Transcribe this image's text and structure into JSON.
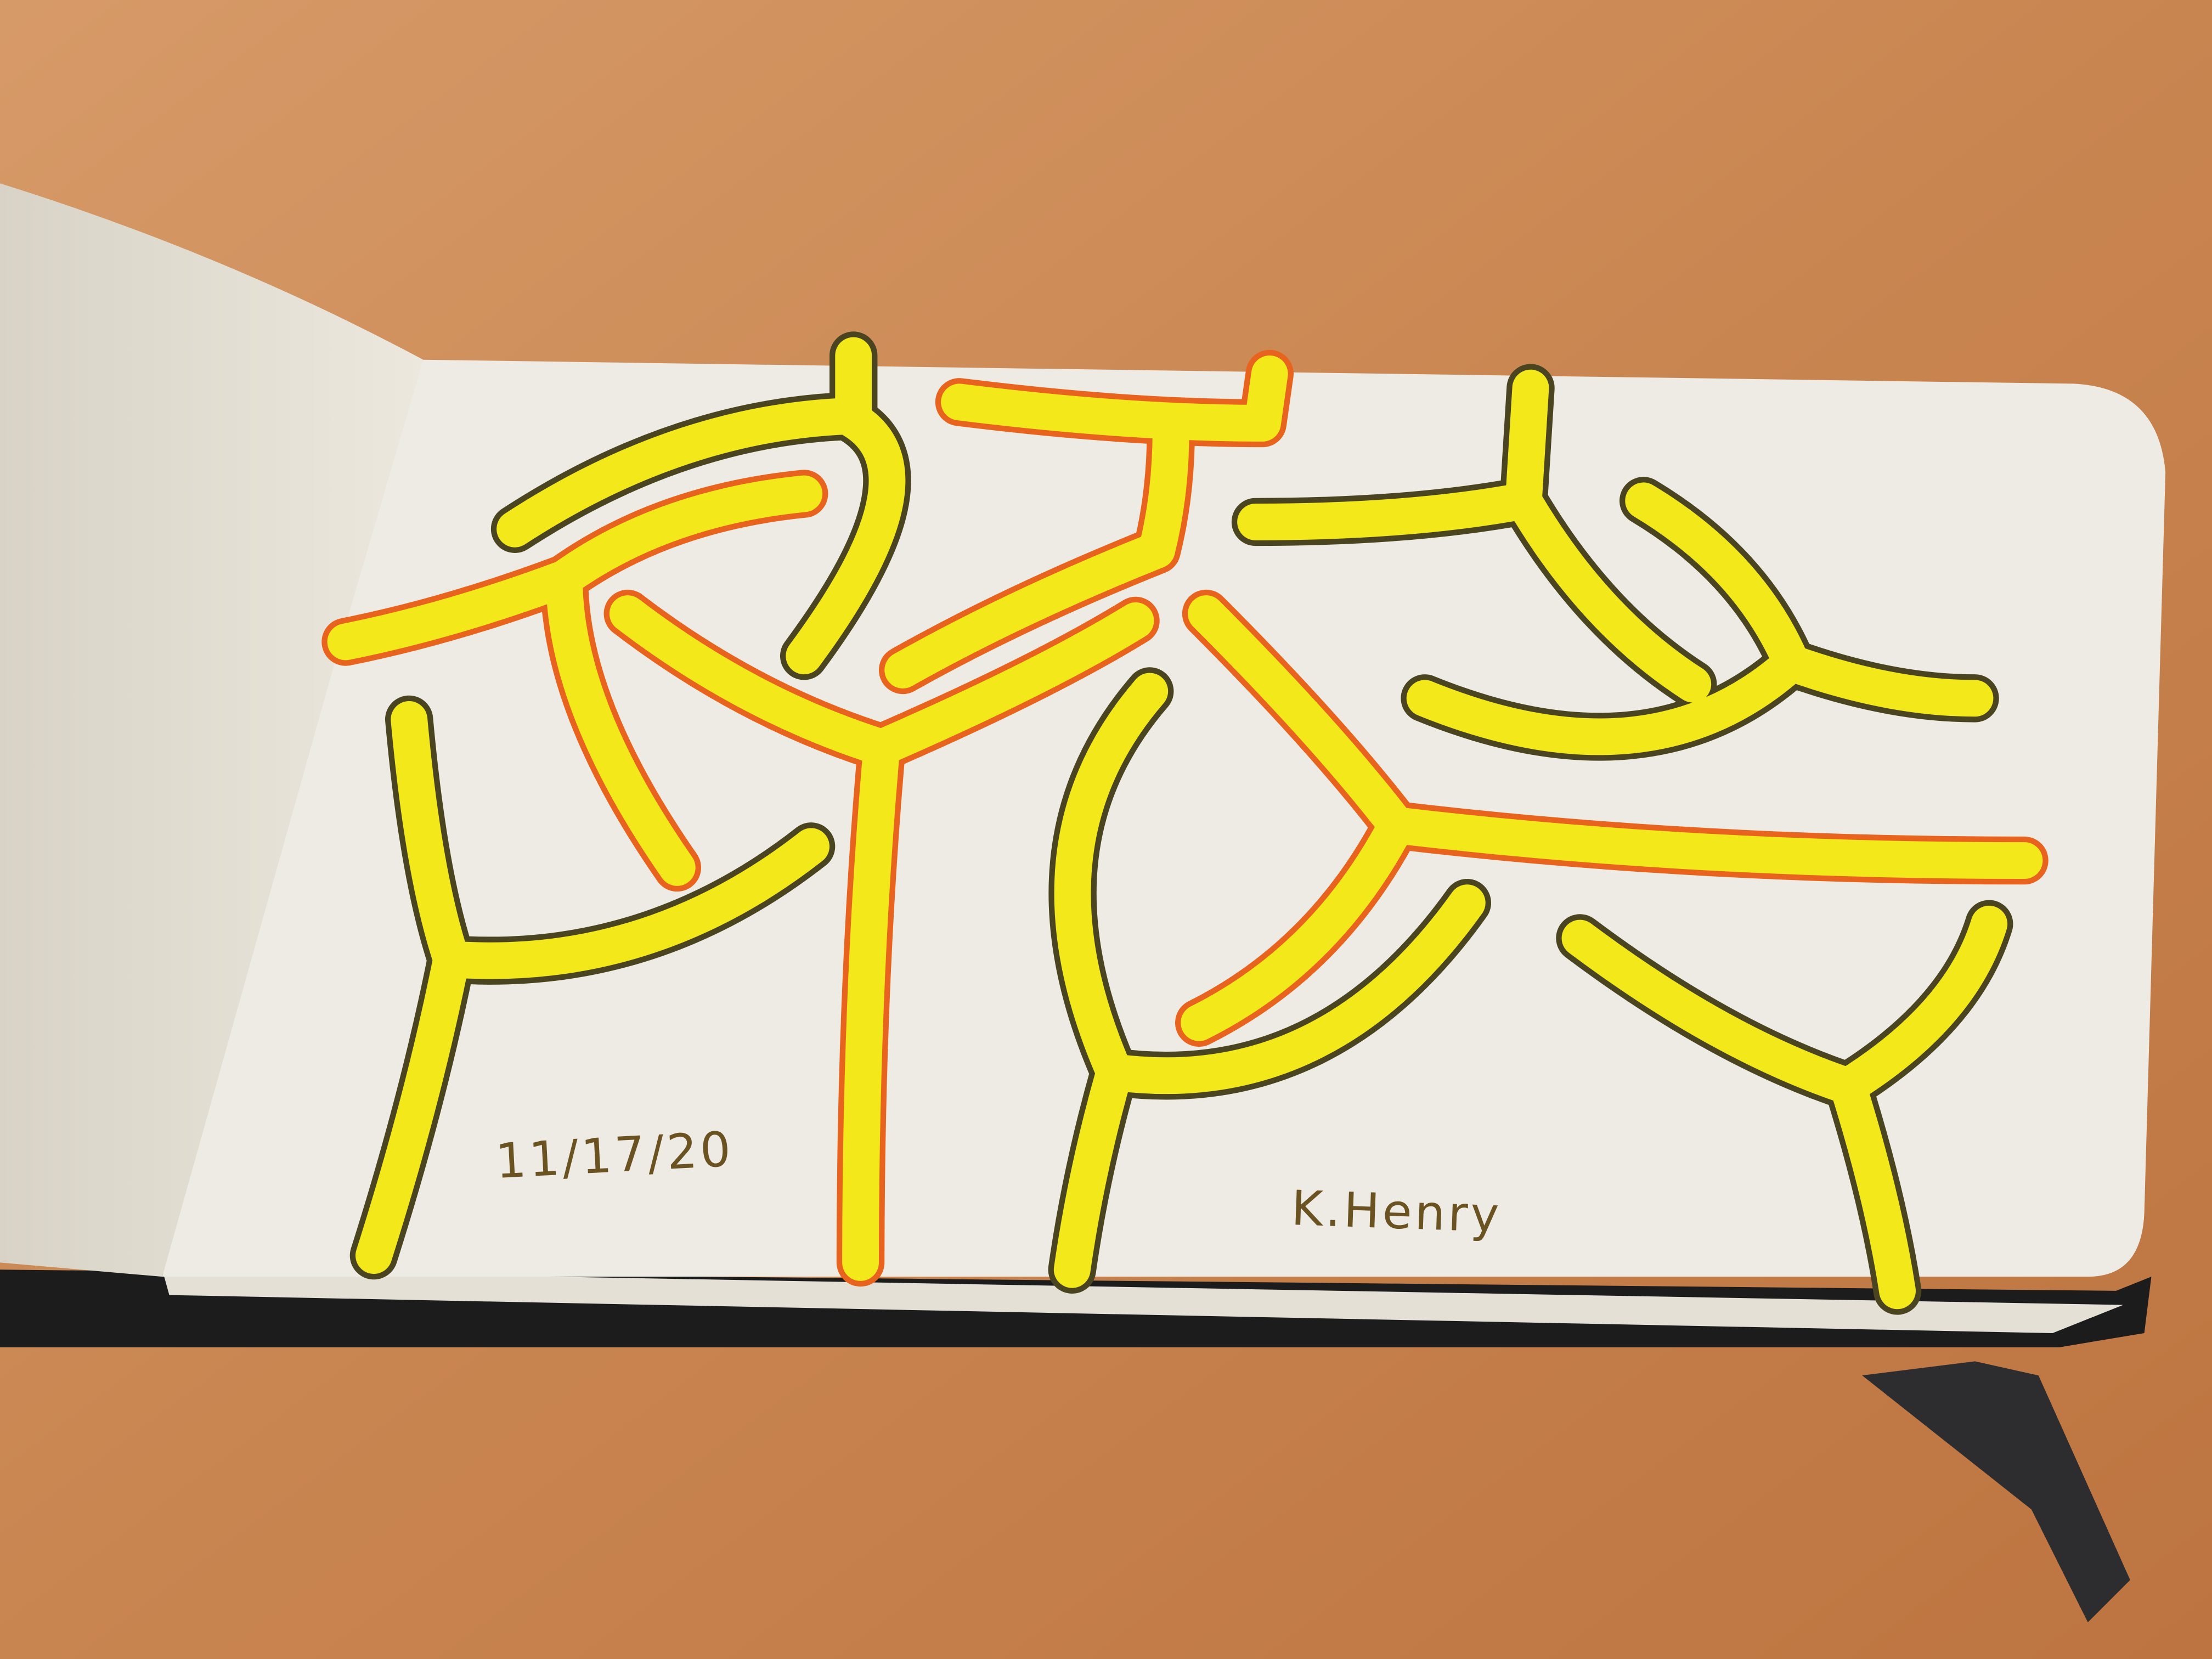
{
  "scene": {
    "subject": "open sketchbook with yellow branching ink drawing",
    "date_text": "11/17/20",
    "signature_text": "K.Henry"
  },
  "colors": {
    "table": "#c8824e",
    "paper": "#efece4",
    "yellow": "#f3e81a",
    "orange_outline": "#e8641e",
    "dark_outline": "#4a4520",
    "ink_text": "#6b5221"
  }
}
